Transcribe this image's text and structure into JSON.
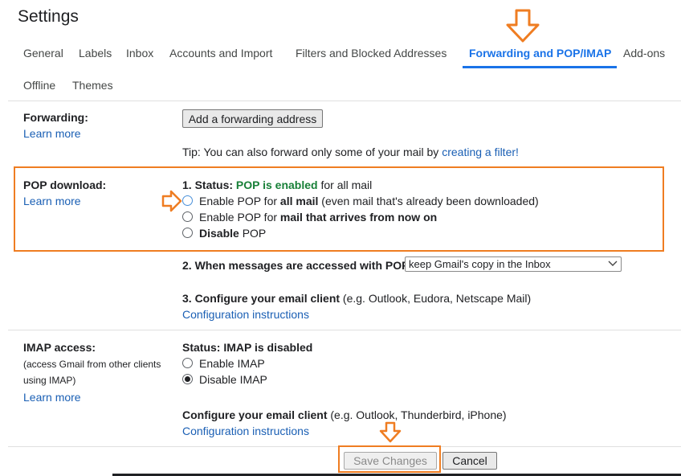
{
  "title": "Settings",
  "tabs": [
    "General",
    "Labels",
    "Inbox",
    "Accounts and Import",
    "Filters and Blocked Addresses",
    "Forwarding and POP/IMAP",
    "Add-ons",
    "Offline",
    "Themes"
  ],
  "forwarding": {
    "label": "Forwarding:",
    "learn_more": "Learn more",
    "add_button": "Add a forwarding address",
    "tip_prefix": "Tip: You can also forward only some of your mail by ",
    "tip_link": "creating a filter!"
  },
  "pop": {
    "label": "POP download:",
    "learn_more": "Learn more",
    "status_prefix": "1. Status: ",
    "status_value": "POP is enabled",
    "status_suffix": " for all mail",
    "opt1_prefix": "Enable POP for ",
    "opt1_bold": "all mail",
    "opt1_suffix": " (even mail that's already been downloaded)",
    "opt2_prefix": "Enable POP for ",
    "opt2_bold": "mail that arrives from now on",
    "opt3_bold": "Disable",
    "opt3_suffix": " POP",
    "access_label": "2. When messages are accessed with POP",
    "access_select": "keep Gmail's copy in the Inbox",
    "configure_bold": "3. Configure your email client",
    "configure_suffix": " (e.g. Outlook, Eudora, Netscape Mail)",
    "config_link": "Configuration instructions"
  },
  "imap": {
    "label": "IMAP access:",
    "sub1": "(access Gmail from other clients",
    "sub2": "using IMAP)",
    "learn_more": "Learn more",
    "status": "Status: IMAP is disabled",
    "opt_enable": "Enable IMAP",
    "opt_disable": "Disable IMAP",
    "configure_bold": "Configure your email client",
    "configure_suffix": " (e.g. Outlook, Thunderbird, iPhone)",
    "config_link": "Configuration instructions"
  },
  "footer": {
    "save": "Save Changes",
    "cancel": "Cancel"
  },
  "colors": {
    "accent": "#1a73e8",
    "annotation": "#ef7d22",
    "status_green": "#188038"
  },
  "icons": [
    "down-arrow-annotation-icon",
    "right-arrow-annotation-icon",
    "chevron-down-icon"
  ]
}
